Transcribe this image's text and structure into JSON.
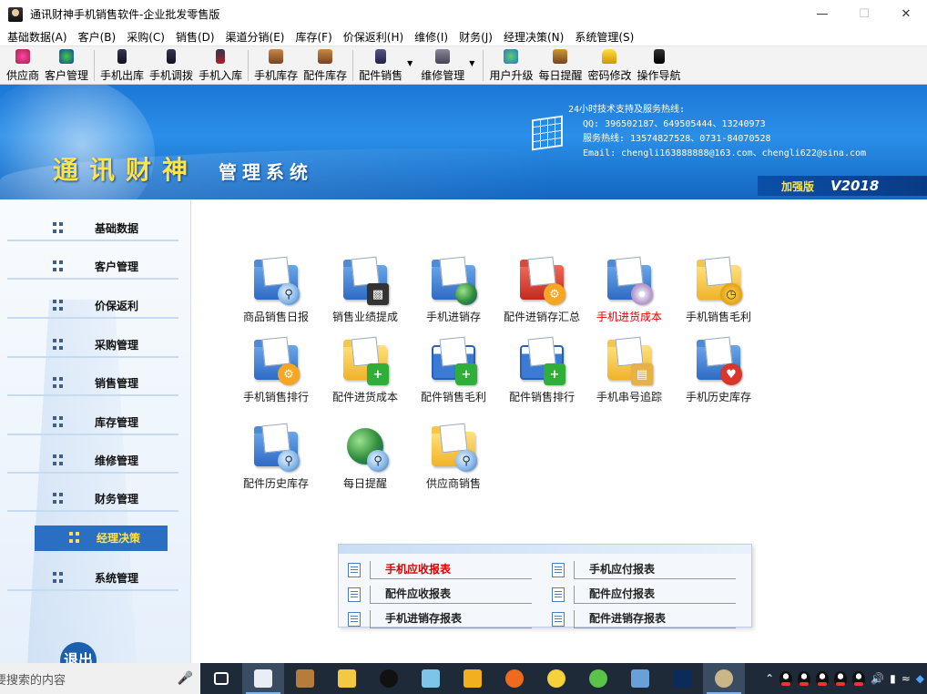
{
  "window": {
    "title": "通讯财神手机销售软件-企业批发零售版",
    "minimize_icon": "minimize-icon",
    "maximize_icon": "maximize-icon",
    "close_icon": "close-icon"
  },
  "menu": [
    "基础数据(A)",
    "客户(B)",
    "采购(C)",
    "销售(D)",
    "渠道分销(E)",
    "库存(F)",
    "价保返利(H)",
    "维修(I)",
    "财务(J)",
    "经理决策(N)",
    "系统管理(S)"
  ],
  "toolbar": {
    "groups": [
      [
        {
          "label": "供应商",
          "icon": "supplier-icon"
        },
        {
          "label": "客户管理",
          "icon": "customer-icon"
        }
      ],
      [
        {
          "label": "手机出库",
          "icon": "phone-out-icon"
        },
        {
          "label": "手机调拨",
          "icon": "phone-transfer-icon"
        },
        {
          "label": "手机入库",
          "icon": "phone-in-icon"
        }
      ],
      [
        {
          "label": "手机库存",
          "icon": "phone-stock-icon"
        },
        {
          "label": "配件库存",
          "icon": "parts-stock-icon"
        }
      ],
      [
        {
          "label": "配件销售",
          "icon": "parts-sales-icon",
          "dropdown": true
        },
        {
          "label": "维修管理",
          "icon": "repair-icon",
          "dropdown": true
        }
      ],
      [
        {
          "label": "用户升级",
          "icon": "upgrade-icon"
        },
        {
          "label": "每日提醒",
          "icon": "reminder-icon"
        },
        {
          "label": "密码修改",
          "icon": "lock-icon"
        },
        {
          "label": "操作导航",
          "icon": "navigation-icon"
        }
      ]
    ]
  },
  "banner": {
    "brand": "通讯财神",
    "system": "管理系统",
    "support_title": "24小时技术支持及服务热线:",
    "qq": "QQ: 396502187、649505444、13240973",
    "hotline": "服务热线: 13574827528、0731-84070528",
    "email": "Email: chengli163888888@163.com、chengli622@sina.com",
    "edition": "加强版",
    "version": "V2018"
  },
  "sidebar": {
    "items": [
      {
        "label": "基础数据"
      },
      {
        "label": "客户管理"
      },
      {
        "label": "价保返利"
      },
      {
        "label": "采购管理"
      },
      {
        "label": "销售管理"
      },
      {
        "label": "库存管理"
      },
      {
        "label": "维修管理"
      },
      {
        "label": "财务管理"
      },
      {
        "label": "经理决策",
        "active": true
      },
      {
        "label": "系统管理"
      }
    ],
    "logout": "退出"
  },
  "reports_icons": [
    {
      "label": "商品销售日报",
      "folder": "blue",
      "badge": "magnifier"
    },
    {
      "label": "销售业绩提成",
      "folder": "blue",
      "badge": "film"
    },
    {
      "label": "手机进销存",
      "folder": "blue",
      "badge": "globe"
    },
    {
      "label": "配件进销存汇总",
      "folder": "red",
      "badge": "wrench"
    },
    {
      "label": "手机进货成本",
      "folder": "blue",
      "badge": "cd",
      "highlight": true
    },
    {
      "label": "手机销售毛利",
      "folder": "yellow",
      "badge": "clock"
    },
    {
      "label": "手机销售排行",
      "folder": "blue",
      "badge": "wrench"
    },
    {
      "label": "配件进货成本",
      "folder": "yellow",
      "badge": "plus"
    },
    {
      "label": "配件销售毛利",
      "folder": "window",
      "badge": "plus"
    },
    {
      "label": "配件销售排行",
      "folder": "window",
      "badge": "plus"
    },
    {
      "label": "手机串号追踪",
      "folder": "yellow",
      "badge": "book"
    },
    {
      "label": "手机历史库存",
      "folder": "blue",
      "badge": "heart"
    },
    {
      "label": "配件历史库存",
      "folder": "blue",
      "badge": "magnifier"
    },
    {
      "label": "每日提醒",
      "folder": "globe",
      "badge": "magnifier"
    },
    {
      "label": "供应商销售",
      "folder": "yellow",
      "badge": "magnifier"
    }
  ],
  "report_links": [
    {
      "label": "手机应收报表",
      "highlight": true
    },
    {
      "label": "手机应付报表"
    },
    {
      "label": "配件应收报表"
    },
    {
      "label": "配件应付报表"
    },
    {
      "label": "手机进销存报表"
    },
    {
      "label": "配件进销存报表"
    }
  ],
  "taskbar": {
    "search_placeholder": "要搜索的内容",
    "apps": [
      "task-view-icon",
      "file-icon",
      "package-icon",
      "folder-icon",
      "qq-icon",
      "notebook-icon",
      "bus-icon",
      "firefox-icon",
      "sogou-icon",
      "wechat-icon",
      "photos-icon",
      "photoshop-icon",
      "money-icon"
    ],
    "tray": [
      "chevron-up-icon",
      "qq-icon",
      "qq-icon",
      "qq-icon",
      "qq-icon",
      "qq-icon",
      "volume-icon",
      "battery-icon",
      "wifi-icon",
      "shield-icon"
    ]
  }
}
